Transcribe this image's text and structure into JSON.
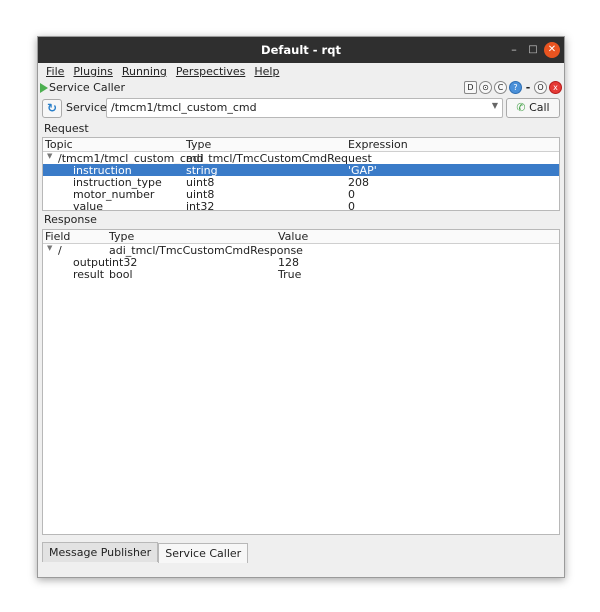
{
  "window": {
    "title": "Default - rqt"
  },
  "menu": [
    "File",
    "Plugins",
    "Running",
    "Perspectives",
    "Help"
  ],
  "plugin": {
    "name": "Service Caller",
    "icons": [
      "D",
      "⊙",
      "C",
      "?",
      "-",
      "O",
      "x"
    ]
  },
  "service": {
    "label": "Service",
    "value": "/tmcm1/tmcl_custom_cmd",
    "call_label": "Call"
  },
  "request": {
    "label": "Request",
    "headers": [
      "Topic",
      "Type",
      "Expression"
    ],
    "rows": [
      {
        "topic": "/tmcm1/tmcl_custom_cmd",
        "type": "adi_tmcl/TmcCustomCmdRequest",
        "expr": ""
      },
      {
        "topic": "instruction",
        "type": "string",
        "expr": "'GAP'"
      },
      {
        "topic": "instruction_type",
        "type": "uint8",
        "expr": "208"
      },
      {
        "topic": "motor_number",
        "type": "uint8",
        "expr": "0"
      },
      {
        "topic": "value",
        "type": "int32",
        "expr": "0"
      }
    ]
  },
  "response": {
    "label": "Response",
    "headers": [
      "Field",
      "Type",
      "Value"
    ],
    "rows": [
      {
        "field": "/",
        "type": "adi_tmcl/TmcCustomCmdResponse",
        "value": ""
      },
      {
        "field": "output",
        "type": "int32",
        "value": "128"
      },
      {
        "field": "result",
        "type": "bool",
        "value": "True"
      }
    ]
  },
  "tabs": [
    "Message Publisher",
    "Service Caller"
  ],
  "colors": {
    "selection": "#3a7bc8",
    "titlebar": "#2f2f2f",
    "close": "#e95420"
  }
}
